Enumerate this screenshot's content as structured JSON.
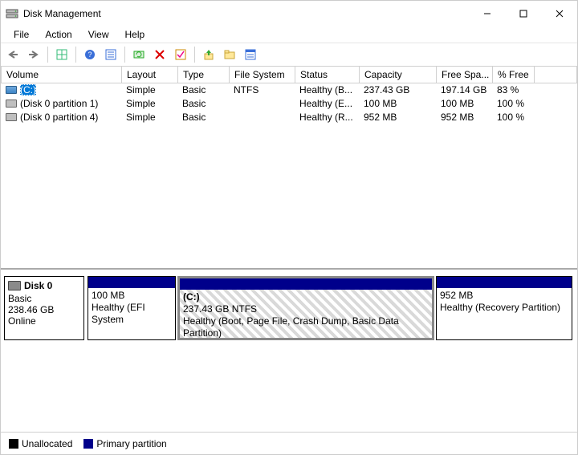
{
  "window": {
    "title": "Disk Management"
  },
  "menus": {
    "file": "File",
    "action": "Action",
    "view": "View",
    "help": "Help"
  },
  "table": {
    "headers": {
      "volume": "Volume",
      "layout": "Layout",
      "type": "Type",
      "fs": "File System",
      "status": "Status",
      "capacity": "Capacity",
      "free": "Free Spa...",
      "pct": "% Free"
    },
    "rows": [
      {
        "icon": "drive",
        "label": "(C:)",
        "layout": "Simple",
        "type": "Basic",
        "fs": "NTFS",
        "status": "Healthy (B...",
        "capacity": "237.43 GB",
        "free": "197.14 GB",
        "pct": "83 %",
        "selected": true
      },
      {
        "icon": "part",
        "label": "(Disk 0 partition 1)",
        "layout": "Simple",
        "type": "Basic",
        "fs": "",
        "status": "Healthy (E...",
        "capacity": "100 MB",
        "free": "100 MB",
        "pct": "100 %",
        "selected": false
      },
      {
        "icon": "part",
        "label": "(Disk 0 partition 4)",
        "layout": "Simple",
        "type": "Basic",
        "fs": "",
        "status": "Healthy (R...",
        "capacity": "952 MB",
        "free": "952 MB",
        "pct": "100 %",
        "selected": false
      }
    ]
  },
  "disk": {
    "name": "Disk 0",
    "type": "Basic",
    "size": "238.46 GB",
    "status": "Online",
    "parts": [
      {
        "title": "",
        "line1": "100 MB",
        "line2": "Healthy (EFI System",
        "flex": 110,
        "selected": false
      },
      {
        "title": "(C:)",
        "line1": "237.43 GB NTFS",
        "line2": "Healthy (Boot, Page File, Crash Dump, Basic Data Partition)",
        "flex": 320,
        "selected": true
      },
      {
        "title": "",
        "line1": "952 MB",
        "line2": "Healthy (Recovery Partition)",
        "flex": 170,
        "selected": false
      }
    ]
  },
  "legend": {
    "unalloc": "Unallocated",
    "primary": "Primary partition"
  }
}
